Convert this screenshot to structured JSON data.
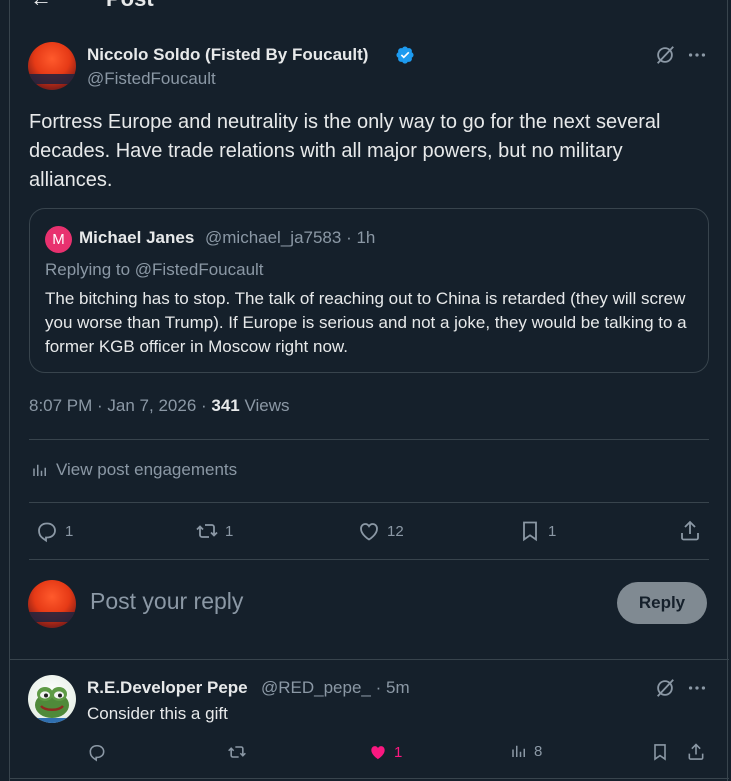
{
  "header": {
    "back_glyph": "←",
    "title": "Post"
  },
  "post": {
    "author_name": "Niccolo Soldo (Fisted By Foucault)",
    "handle": "@FistedFoucault",
    "text": "Fortress Europe and neutrality is the only way to go for the next several decades.  Have trade relations with all major powers, but no military alliances.",
    "quote": {
      "avatar_letter": "M",
      "author_name": "Michael Janes",
      "handle_time": "@michael_ja7583 · 1h",
      "replying_to": "Replying to @FistedFoucault",
      "text": "The bitching has to stop. The talk of reaching out to China is retarded (they will screw you worse than Trump). If Europe is serious and not a joke, they would be talking to a former KGB officer in Moscow right now."
    },
    "timestamp": "8:07 PM · Jan 7, 2026 · ",
    "views_count": "341",
    "views_label": " Views",
    "engagements_label": "View post engagements",
    "actions": {
      "replies": "1",
      "reposts": "1",
      "likes": "12",
      "bookmarks": "1"
    }
  },
  "reply_box": {
    "placeholder": "Post your reply",
    "button_label": "Reply"
  },
  "reply": {
    "author_name": "R.E.Developer Pepe",
    "handle_time": "@RED_pepe_ · 5m",
    "text": "Consider this a gift",
    "actions": {
      "likes": "1",
      "views": "8"
    }
  },
  "colors": {
    "background": "#15202b",
    "accent": "#1d9bf0",
    "like_active": "#f91880",
    "muted": "#8b98a5"
  },
  "icons": [
    "back-arrow-icon",
    "verified-badge-icon",
    "grok-icon",
    "more-icon",
    "reply-icon",
    "repost-icon",
    "like-icon",
    "bookmark-icon",
    "share-icon",
    "analytics-icon"
  ]
}
